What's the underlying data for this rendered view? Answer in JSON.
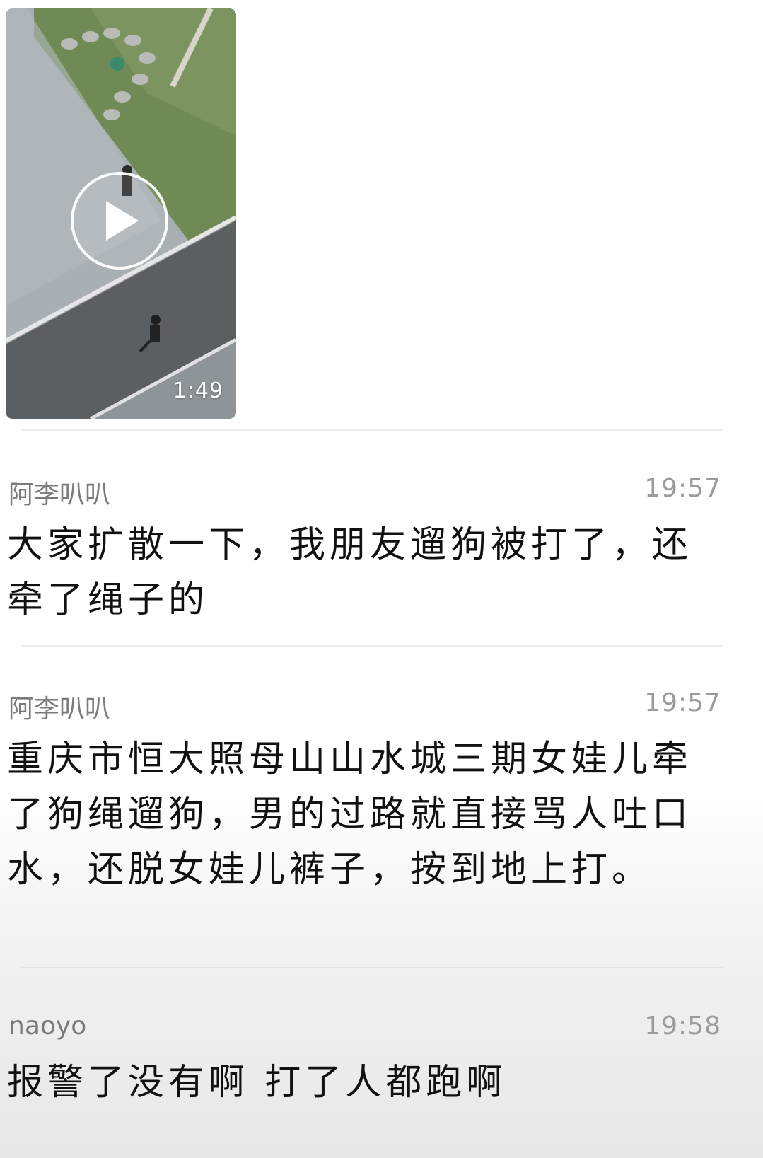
{
  "video": {
    "duration": "1:49"
  },
  "messages": [
    {
      "sender": "阿李叭叭",
      "time": "19:57",
      "text": "大家扩散一下，我朋友遛狗被打了，还牵了绳子的"
    },
    {
      "sender": "阿李叭叭",
      "time": "19:57",
      "text": "重庆市恒大照母山山水城三期女娃儿牵了狗绳遛狗，男的过路就直接骂人吐口水，还脱女娃儿裤子，按到地上打。"
    },
    {
      "sender": "naoyo",
      "time": "19:58",
      "text": "报警了没有啊 打了人都跑啊"
    }
  ]
}
